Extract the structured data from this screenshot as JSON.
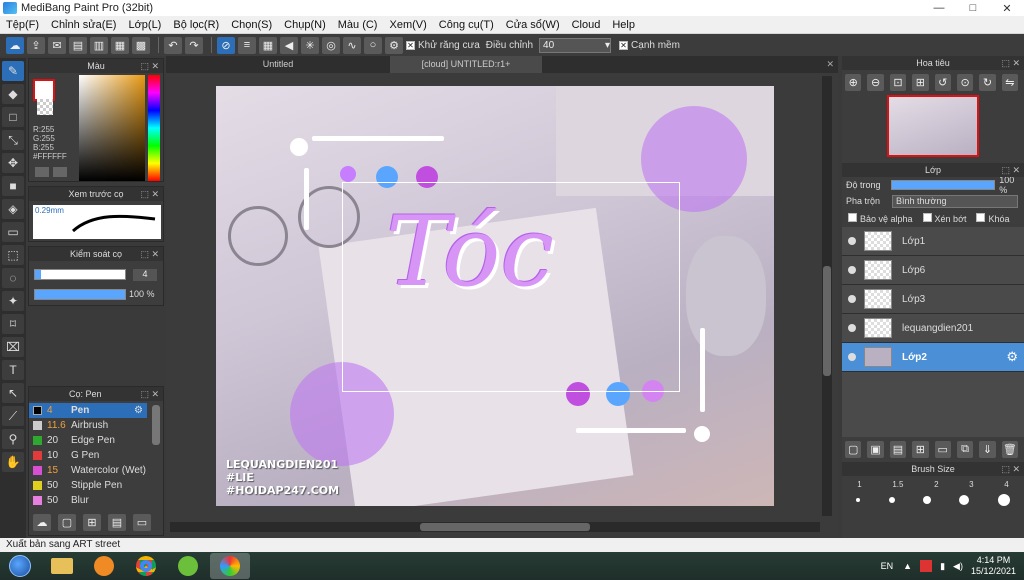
{
  "window": {
    "title": "MediBang Paint Pro (32bit)",
    "min": "—",
    "max": "□",
    "close": "✕"
  },
  "menu": [
    "Tệp(F)",
    "Chỉnh sửa(E)",
    "Lớp(L)",
    "Bộ lọc(R)",
    "Chọn(S)",
    "Chụp(N)",
    "Màu (C)",
    "Xem(V)",
    "Công cụ(T)",
    "Cửa sổ(W)",
    "Cloud",
    "Help"
  ],
  "toolbar": {
    "antialias_label": "Khử răng cưa",
    "adjust_label": "Điều chỉnh",
    "adjust_value": "40",
    "edge_label": "Cạnh mềm"
  },
  "color_panel": {
    "title": "Màu",
    "r": "R:255",
    "g": "G:255",
    "b": "B:255",
    "hex": "#FFFFFF"
  },
  "brush_preview": {
    "title": "Xem trước cọ",
    "size": "0.29mm"
  },
  "brush_control": {
    "title": "Kiểm soát cọ",
    "size_value": "4",
    "opacity_value": "100 %"
  },
  "brush_list": {
    "title": "Cọ: Pen",
    "items": [
      {
        "size": "4",
        "name": "Pen",
        "color": "#000000",
        "active": true
      },
      {
        "size": "11.6",
        "name": "Airbrush",
        "color": "#cccccc"
      },
      {
        "size": "20",
        "name": "Edge Pen",
        "color": "#2fa82f"
      },
      {
        "size": "10",
        "name": "G Pen",
        "color": "#e23b3b"
      },
      {
        "size": "15",
        "name": "Watercolor (Wet)",
        "color": "#d94fd4"
      },
      {
        "size": "50",
        "name": "Stipple Pen",
        "color": "#e0d020"
      },
      {
        "size": "50",
        "name": "Blur",
        "color": "#e77fe0"
      }
    ]
  },
  "tabs": [
    {
      "label": "Untitled"
    },
    {
      "label": "[cloud] UNTITLED:r1+"
    }
  ],
  "artwork": {
    "title_text": "Tóc",
    "watermark": [
      "LEQUANGDIEN201",
      "#LIE",
      "#HOIDAP247.COM"
    ],
    "colors": {
      "purple": "#c77dff",
      "blue": "#5aa6ff",
      "pink": "#e0a3ff"
    }
  },
  "navigator": {
    "title": "Hoa tiêu"
  },
  "layers_panel": {
    "title": "Lớp",
    "opacity_label": "Độ trong",
    "opacity_value": "100 %",
    "blend_label": "Pha trộn",
    "blend_value": "Bình thường",
    "protect_alpha": "Bảo vệ alpha",
    "clip": "Xén bớt",
    "lock": "Khóa",
    "layers": [
      {
        "name": "Lớp1",
        "active": false
      },
      {
        "name": "Lớp6",
        "active": false
      },
      {
        "name": "Lớp3",
        "active": false
      },
      {
        "name": "lequangdien201",
        "active": false
      },
      {
        "name": "Lớp2",
        "active": true
      }
    ]
  },
  "brush_size_panel": {
    "title": "Brush Size",
    "sizes": [
      "1",
      "1.5",
      "2",
      "3",
      "4"
    ]
  },
  "status": {
    "text": "Xuất bản sang ART street"
  },
  "taskbar": {
    "lang": "EN",
    "time": "4:14 PM",
    "date": "15/12/2021"
  }
}
